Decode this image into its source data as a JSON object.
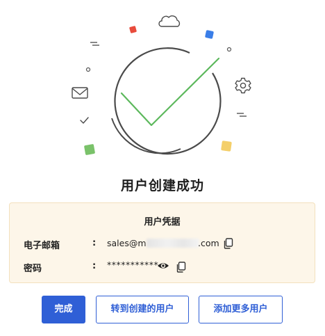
{
  "dialog": {
    "title": "用户创建成功"
  },
  "credentials": {
    "section_title": "用户凭据",
    "email_label": "电子邮箱",
    "email_value_prefix": "sales@m",
    "email_value_suffix": ".com",
    "password_label": "密码",
    "password_value": "***********",
    "separator": ":"
  },
  "buttons": {
    "done": "完成",
    "go_to_user": "转到创建的用户",
    "add_more": "添加更多用户"
  },
  "colors": {
    "primary": "#2f5fd6",
    "success_check": "#5cb85c",
    "credentials_bg": "#fdf6e9"
  },
  "icons": {
    "copy": "copy-icon",
    "eye": "eye-icon",
    "check": "check-icon",
    "cloud": "cloud-icon",
    "mail": "mail-icon",
    "gear": "gear-icon"
  }
}
